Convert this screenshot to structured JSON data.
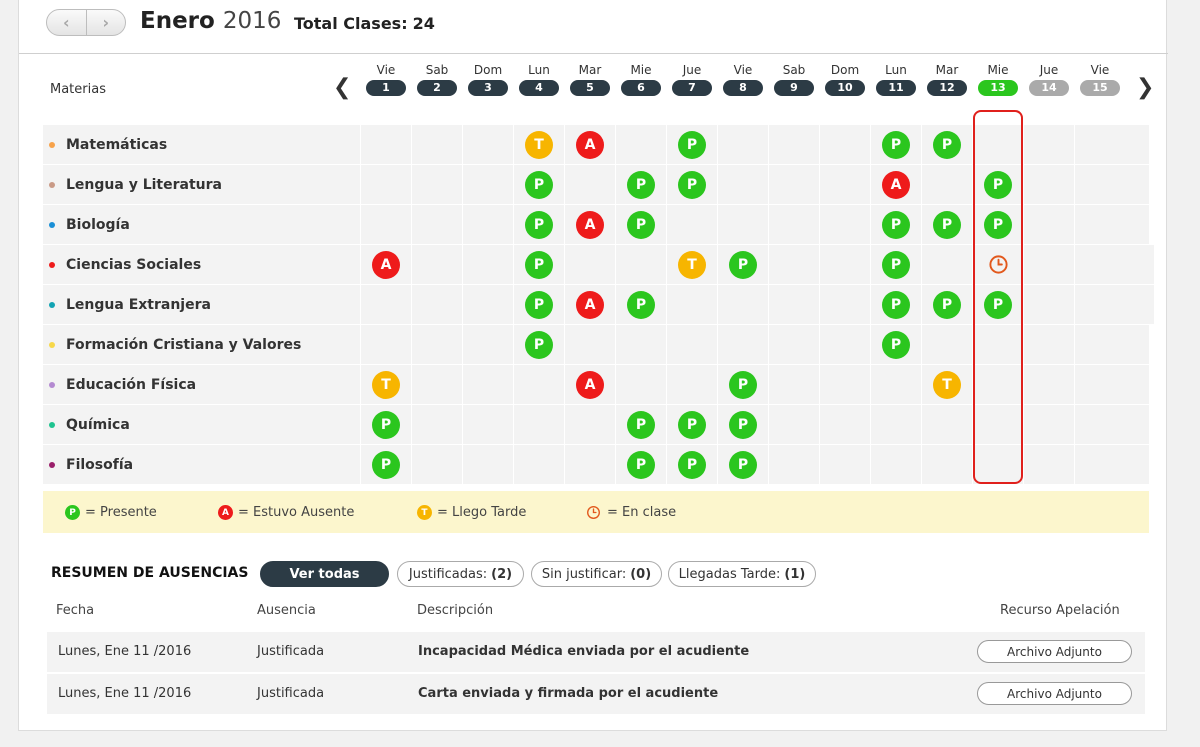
{
  "header": {
    "month": "Enero",
    "year": "2016",
    "total_label": "Total Clases:",
    "total_value": "24",
    "prev_icon": "chevron-left-icon",
    "next_icon": "chevron-right-icon"
  },
  "calendar": {
    "materias_label": "Materias",
    "days": [
      {
        "name": "Vie",
        "num": "1",
        "state": "past"
      },
      {
        "name": "Sab",
        "num": "2",
        "state": "past"
      },
      {
        "name": "Dom",
        "num": "3",
        "state": "past"
      },
      {
        "name": "Lun",
        "num": "4",
        "state": "past"
      },
      {
        "name": "Mar",
        "num": "5",
        "state": "past"
      },
      {
        "name": "Mie",
        "num": "6",
        "state": "past"
      },
      {
        "name": "Jue",
        "num": "7",
        "state": "past"
      },
      {
        "name": "Vie",
        "num": "8",
        "state": "past"
      },
      {
        "name": "Sab",
        "num": "9",
        "state": "past"
      },
      {
        "name": "Dom",
        "num": "10",
        "state": "past"
      },
      {
        "name": "Lun",
        "num": "11",
        "state": "past"
      },
      {
        "name": "Mar",
        "num": "12",
        "state": "past"
      },
      {
        "name": "Mie",
        "num": "13",
        "state": "today"
      },
      {
        "name": "Jue",
        "num": "14",
        "state": "future"
      },
      {
        "name": "Vie",
        "num": "15",
        "state": "future"
      }
    ],
    "subjects": [
      {
        "name": "Matemáticas",
        "color": "#f7a24a",
        "marks": [
          "",
          "",
          "",
          "T",
          "A",
          "",
          "P",
          "",
          "",
          "",
          "P",
          "P",
          "",
          "",
          ""
        ]
      },
      {
        "name": "Lengua y Literatura",
        "color": "#c99a86",
        "marks": [
          "",
          "",
          "",
          "P",
          "",
          "P",
          "P",
          "",
          "",
          "",
          "A",
          "",
          "P",
          "",
          ""
        ]
      },
      {
        "name": "Biología",
        "color": "#1a8fd6",
        "marks": [
          "",
          "",
          "",
          "P",
          "A",
          "P",
          "",
          "",
          "",
          "",
          "P",
          "P",
          "P",
          "",
          ""
        ]
      },
      {
        "name": "Ciencias Sociales",
        "color": "#ee1b1b",
        "marks": [
          "A",
          "",
          "",
          "P",
          "",
          "",
          "T",
          "P",
          "",
          "",
          "P",
          "",
          "C",
          "",
          ""
        ]
      },
      {
        "name": "Lengua Extranjera",
        "color": "#12a3b3",
        "marks": [
          "",
          "",
          "",
          "P",
          "A",
          "P",
          "",
          "",
          "",
          "",
          "P",
          "P",
          "P",
          "",
          ""
        ]
      },
      {
        "name": "Formación Cristiana y Valores",
        "color": "#f7d84a",
        "marks": [
          "",
          "",
          "",
          "P",
          "",
          "",
          "",
          "",
          "",
          "",
          "P",
          "",
          "",
          "",
          ""
        ]
      },
      {
        "name": "Educación Física",
        "color": "#b48ad1",
        "marks": [
          "T",
          "",
          "",
          "",
          "A",
          "",
          "",
          "P",
          "",
          "",
          "",
          "T",
          "",
          "",
          ""
        ]
      },
      {
        "name": "Química",
        "color": "#1fc38f",
        "marks": [
          "P",
          "",
          "",
          "",
          "",
          "P",
          "P",
          "P",
          "",
          "",
          "",
          "",
          "",
          "",
          ""
        ]
      },
      {
        "name": "Filosofía",
        "color": "#9a1f6a",
        "marks": [
          "P",
          "",
          "",
          "",
          "",
          "P",
          "P",
          "P",
          "",
          "",
          "",
          "",
          "",
          "",
          ""
        ]
      }
    ]
  },
  "legend": [
    {
      "symbol": "P",
      "text": "= Presente"
    },
    {
      "symbol": "A",
      "text": "= Estuvo Ausente"
    },
    {
      "symbol": "T",
      "text": "= Llego Tarde"
    },
    {
      "symbol": "C",
      "text": "= En clase"
    }
  ],
  "summary": {
    "title": "RESUMEN DE AUSENCIAS",
    "filters": [
      {
        "label": "Ver todas",
        "count": "",
        "active": true
      },
      {
        "label": "Justificadas:",
        "count": "(2)",
        "active": false
      },
      {
        "label": "Sin justificar:",
        "count": "(0)",
        "active": false
      },
      {
        "label": "Llegadas Tarde:",
        "count": "(1)",
        "active": false
      }
    ],
    "columns": {
      "fecha": "Fecha",
      "ausencia": "Ausencia",
      "descripcion": "Descripción",
      "recurso": "Recurso Apelación"
    },
    "rows": [
      {
        "fecha": "Lunes, Ene 11 /2016",
        "ausencia": "Justificada",
        "descripcion": "Incapacidad Médica enviada por el acudiente",
        "recurso": "Archivo Adjunto"
      },
      {
        "fecha": "Lunes, Ene 11 /2016",
        "ausencia": "Justificada",
        "descripcion": "Carta enviada y firmada por el acudiente",
        "recurso": "Archivo Adjunto"
      }
    ]
  },
  "colors": {
    "present": "#2bc61e",
    "absent": "#ee1b1b",
    "late": "#f7b500",
    "in_class": "#e2581c",
    "today_outline": "#e0201c",
    "dark": "#2c3b45"
  }
}
